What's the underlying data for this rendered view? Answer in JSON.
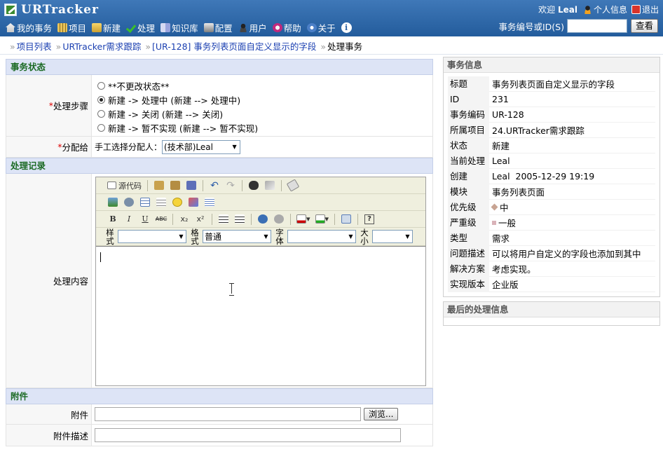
{
  "header": {
    "logo_text": "URTracker",
    "welcome": "欢迎",
    "username": "Leal",
    "profile_label": "个人信息",
    "logout_label": "退出",
    "nav": [
      {
        "label": "我的事务",
        "icon": "home-icon"
      },
      {
        "label": "项目",
        "icon": "project-icon"
      },
      {
        "label": "新建",
        "icon": "new-icon"
      },
      {
        "label": "处理",
        "icon": "check-icon"
      },
      {
        "label": "知识库",
        "icon": "knowledge-icon"
      },
      {
        "label": "配置",
        "icon": "config-icon"
      },
      {
        "label": "用户",
        "icon": "user-icon"
      },
      {
        "label": "帮助",
        "icon": "help-icon"
      },
      {
        "label": "关于",
        "icon": "about-icon"
      }
    ],
    "info_glyph": "i",
    "search_label": "事务编号或ID(S)",
    "search_value": "",
    "search_button": "查看"
  },
  "breadcrumb": {
    "sep": "»",
    "items": [
      "项目列表",
      "URTracker需求跟踪",
      "[UR-128] 事务列表页面自定义显示的字段"
    ],
    "current": "处理事务"
  },
  "form": {
    "status_section": "事务状态",
    "step_label": "处理步骤",
    "required_mark": "*",
    "steps": [
      {
        "label": "**不更改状态**",
        "selected": false
      },
      {
        "label": "新建  -> 处理中 (新建  --> 处理中)",
        "selected": true
      },
      {
        "label": "新建  -> 关闭 (新建  --> 关闭)",
        "selected": false
      },
      {
        "label": "新建  -> 暂不实现 (新建  --> 暂不实现)",
        "selected": false
      }
    ],
    "assign_label": "分配给",
    "assign_hint": "手工选择分配人：",
    "assign_value": "(技术部)Leal",
    "record_section": "处理记录",
    "content_label": "处理内容",
    "editor": {
      "source_label": "源代码",
      "style_label": "样式",
      "format_label": "格式",
      "format_value": "普通",
      "font_label": "字体",
      "size_label": "大小",
      "bold": "B",
      "italic": "I",
      "underline": "U",
      "strike": "ABC",
      "sub": "x₂",
      "sup": "x²",
      "help": "?"
    },
    "attach_section": "附件",
    "attach_label": "附件",
    "browse_button": "浏览...",
    "attach_desc_label": "附件描述"
  },
  "issue_info": {
    "title": "事务信息",
    "rows": [
      {
        "k": "标题",
        "v": "事务列表页面自定义显示的字段"
      },
      {
        "k": "ID",
        "v": "231"
      },
      {
        "k": "事务编码",
        "v": "UR-128"
      },
      {
        "k": "所属项目",
        "v": "24.URTracker需求跟踪"
      },
      {
        "k": "状态",
        "v": "新建"
      },
      {
        "k": "当前处理",
        "v": "Leal"
      },
      {
        "k": "创建",
        "v": "Leal  2005-12-29 19:19"
      },
      {
        "k": "模块",
        "v": "事务列表页面"
      },
      {
        "k": "优先级",
        "v": "中"
      },
      {
        "k": "严重级",
        "v": "一般"
      },
      {
        "k": "类型",
        "v": "需求"
      },
      {
        "k": "问题描述",
        "v": "可以将用户自定义的字段也添加到其中"
      },
      {
        "k": "解决方案",
        "v": "考虑实现。"
      },
      {
        "k": "实现版本",
        "v": "企业版"
      }
    ]
  },
  "last_info": {
    "title": "最后的处理信息"
  }
}
